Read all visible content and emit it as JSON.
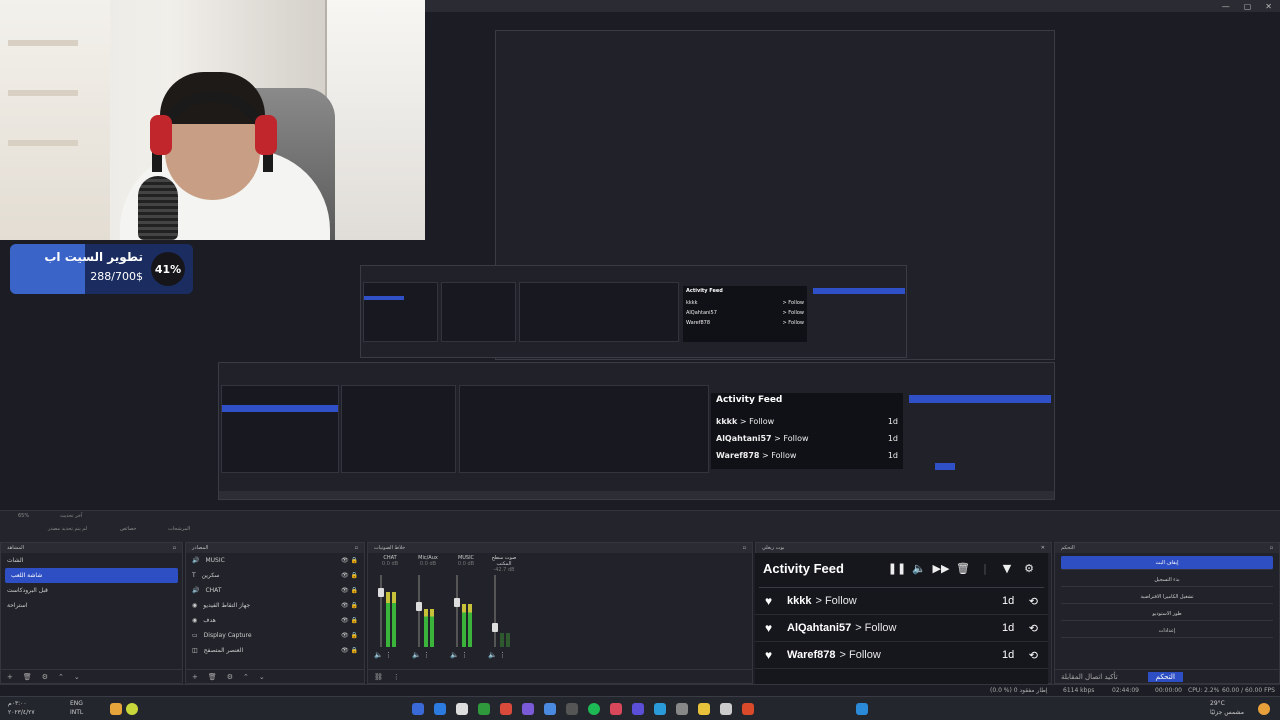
{
  "window": {
    "controls": [
      "—",
      "▢",
      "✕"
    ]
  },
  "goal": {
    "title": "تطوير السيت اب",
    "amount": "288/700$",
    "percent": "41%",
    "progress": 0.41,
    "color": "#3b64c8"
  },
  "mini_feeds": {
    "large": {
      "title": "Activity Feed",
      "rows": [
        {
          "user": "kkkk",
          "action": "> Follow",
          "time": "1d"
        },
        {
          "user": "AlQahtani57",
          "action": "> Follow",
          "time": "1d"
        },
        {
          "user": "Waref878",
          "action": "> Follow",
          "time": "1d"
        }
      ]
    },
    "small": {
      "title": "Activity Feed",
      "rows": [
        {
          "user": "kkkk",
          "action": "> Follow"
        },
        {
          "user": "AlQahtani57",
          "action": "> Follow"
        },
        {
          "user": "Waref878",
          "action": "> Follow"
        }
      ]
    }
  },
  "scene_strip": {
    "left_label": "آخر تحديث",
    "zoom": "65%",
    "buttons": [
      "لم يتم تحديد مصدر",
      "خصائص",
      "المرشحات"
    ]
  },
  "scenes": {
    "title": "المشاهد",
    "items": [
      "الشات",
      "شاشة اللعب",
      "قبل البرودكاست",
      "استراحة"
    ],
    "selected_index": 1
  },
  "sources": {
    "title": "المصادر",
    "items": [
      {
        "icon": "audio-icon",
        "label": "MUSIC"
      },
      {
        "icon": "text-icon",
        "label": "سكرين"
      },
      {
        "icon": "audio-icon",
        "label": "CHAT"
      },
      {
        "icon": "camera-icon",
        "label": "جهاز التقاط الفيديو"
      },
      {
        "icon": "camera-icon",
        "label": "هدف"
      },
      {
        "icon": "monitor-icon",
        "label": "Display Capture"
      },
      {
        "icon": "browser-icon",
        "label": "العنصر المتصفح"
      }
    ]
  },
  "mixer": {
    "title": "خلاط الصوتيات",
    "channels": [
      {
        "name": "CHAT",
        "db": "0.0 dB",
        "level": 0.78
      },
      {
        "name": "Mic/Aux",
        "db": "0.0 dB",
        "level": 0.55
      },
      {
        "name": "MUSIC",
        "db": "0.0 dB",
        "level": 0.62
      },
      {
        "name": "صوت سطح المكتب",
        "db": "-42.7 dB",
        "level": 0.2
      }
    ]
  },
  "activity_dock": {
    "title": "بوت ريغلي"
  },
  "activity_feed": {
    "title": "Activity Feed",
    "rows": [
      {
        "user": "kkkk",
        "action": "> Follow",
        "time": "1d"
      },
      {
        "user": "AlQahtani57",
        "action": "> Follow",
        "time": "1d"
      },
      {
        "user": "Waref878",
        "action": "> Follow",
        "time": "1d"
      }
    ]
  },
  "controls": {
    "title": "التحكم",
    "buttons": [
      "إيقاف البث",
      "بدء التسجيل",
      "تشغيل الكاميرا الافتراضية",
      "طور الاستوديو",
      "إعدادات"
    ],
    "footer": [
      "تأكيد اتصال المقابلة",
      "التحكم"
    ]
  },
  "statusbar": {
    "dropped": "(0.0 %) 0 إطار مفقود",
    "bitrate": "6114 kbps",
    "live": "02:44:09",
    "rec": "00:00:00",
    "cpu": "CPU: 2.2%",
    "fps": "60.00 / 60.00 FPS"
  },
  "taskbar": {
    "lang_top": "ENG",
    "lang_bottom": "INTL",
    "time": "٠٣:٠٠م",
    "date": "٢٠٢٣/٤/٢٧",
    "weather_temp": "29°C",
    "weather_text": "مشمس جزئيًا"
  }
}
